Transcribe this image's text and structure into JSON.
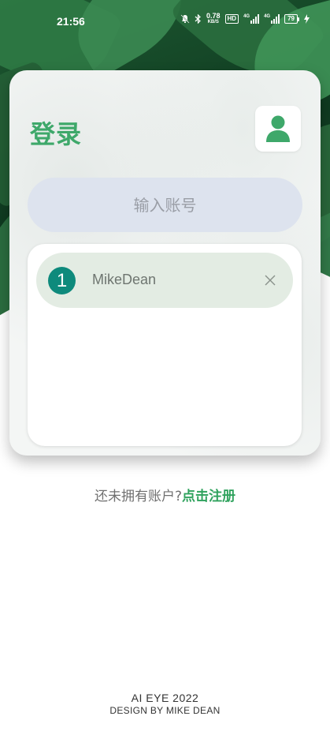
{
  "status_bar": {
    "time": "21:56",
    "net_speed_value": "0.78",
    "net_speed_unit": "KB/S",
    "hd_label": "HD",
    "signal1_label": "4G",
    "signal2_label": "4G",
    "battery_level": "79"
  },
  "login": {
    "title": "登录",
    "account_input_placeholder": "输入账号"
  },
  "saved_accounts": [
    {
      "index": "1",
      "name": "MikeDean"
    }
  ],
  "register": {
    "prompt": "还未拥有账户?",
    "link_label": "点击注册"
  },
  "footer": {
    "line1": "AI EYE 2022",
    "line2": "DESIGN BY MIKE DEAN"
  },
  "colors": {
    "accent_green": "#3ea86a",
    "index_badge": "#0e8a7c",
    "input_bg": "#dde3ee",
    "account_item_bg": "#e3ece3"
  }
}
